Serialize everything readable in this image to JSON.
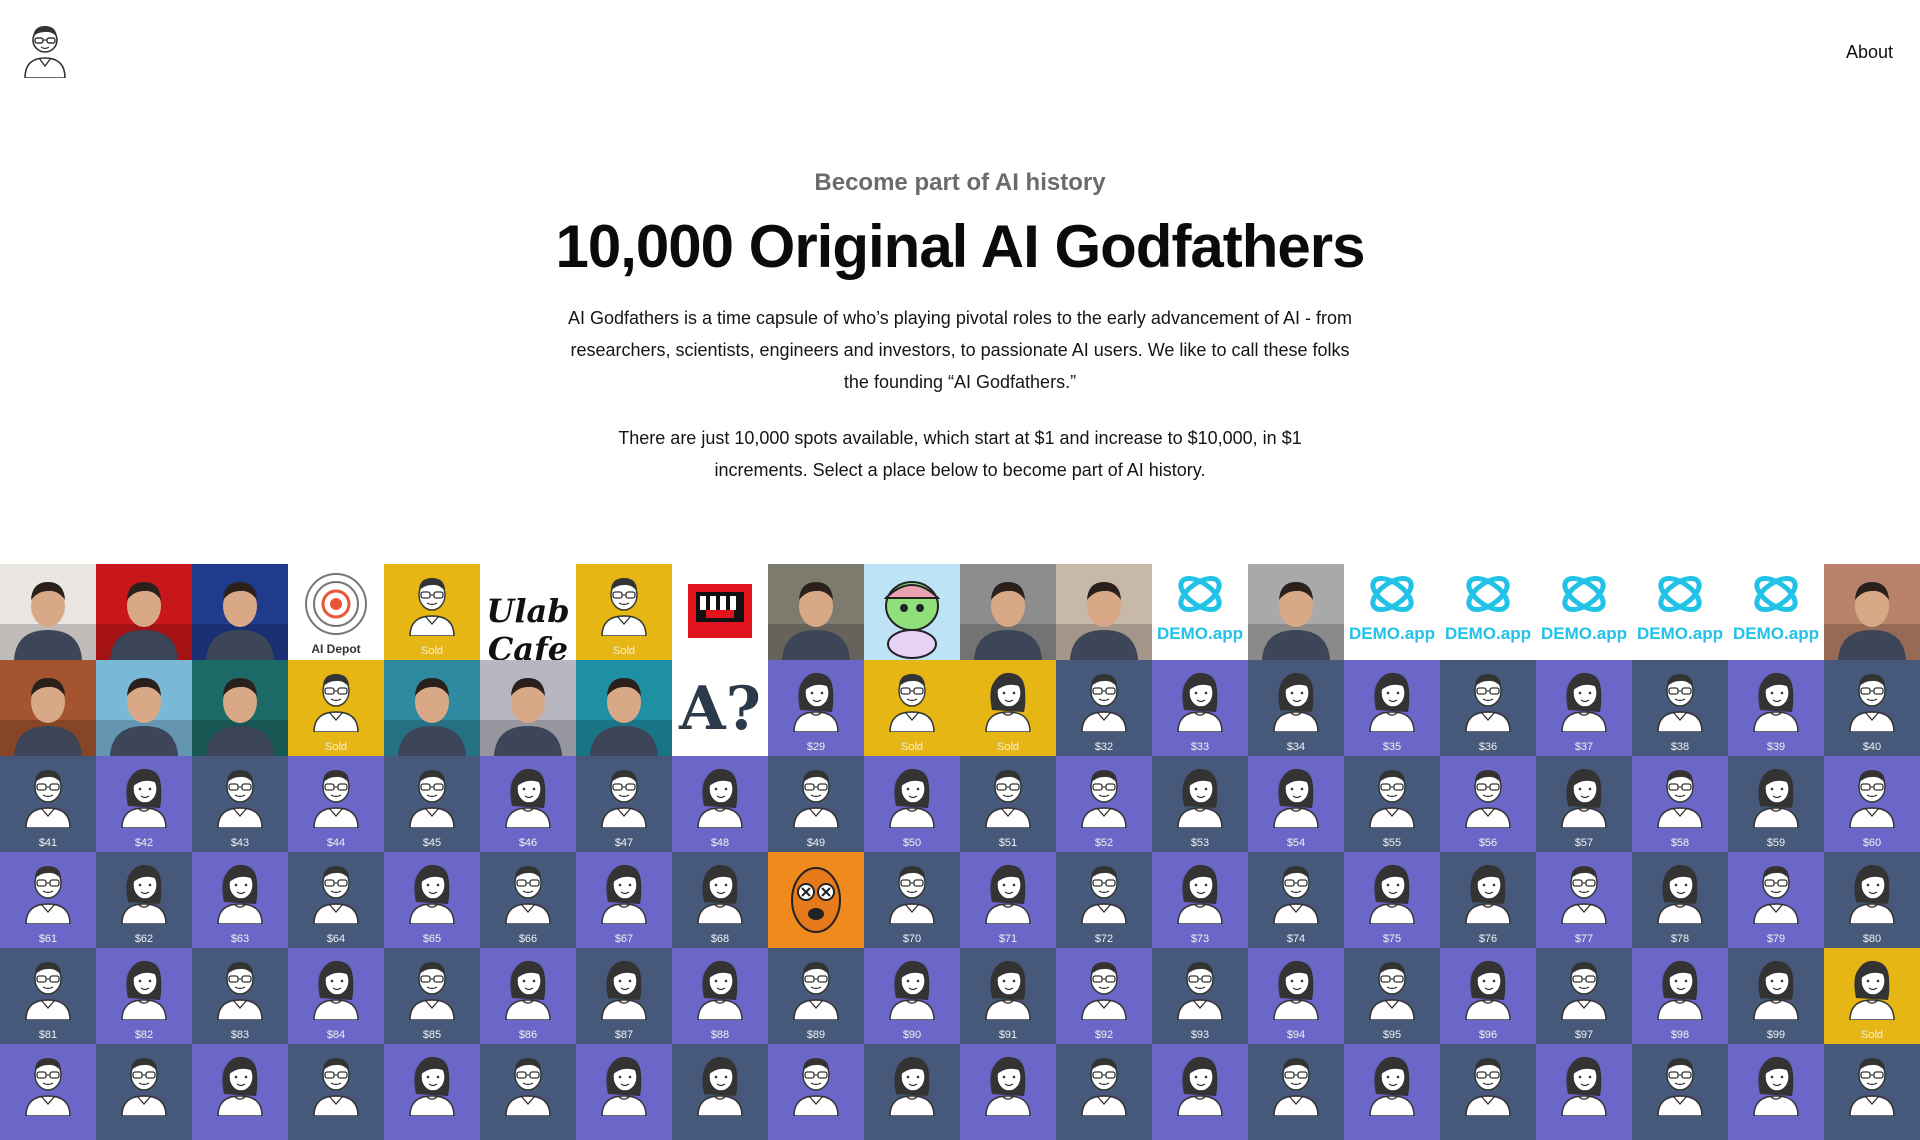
{
  "header": {
    "logo_icon": "godfather-avatar-icon",
    "about_label": "About"
  },
  "hero": {
    "kicker": "Become part of AI history",
    "title": "10,000 Original AI Godfathers",
    "paragraph1": "AI Godfathers is a time capsule of who’s playing pivotal roles to the early advancement of AI - from researchers, scientists, engineers and investors, to passionate AI users. We like to call these folks the founding “AI Godfathers.”",
    "paragraph2": "There are just 10,000 spots available, which start at $1 and increase to $10,000, in $1 increments. Select a place below to become part of AI history."
  },
  "colors": {
    "blue": "#47597a",
    "purple": "#6a67c8",
    "gold": "#e5b614"
  },
  "tiles": [
    {
      "type": "photo",
      "bg": "#e9e5e1"
    },
    {
      "type": "photo",
      "bg": "#c8171b"
    },
    {
      "type": "photo",
      "bg": "#1f3b8c"
    },
    {
      "type": "logo",
      "bg": "#ffffff",
      "text": "AI Depot",
      "icon": "target-icon"
    },
    {
      "type": "sold",
      "bg": "#e5b614",
      "label": "Sold",
      "icon": "male-avatar-icon"
    },
    {
      "type": "logo",
      "bg": "#ffffff",
      "text": "Ulab Cafe",
      "icon": "blackletter-logo"
    },
    {
      "type": "sold",
      "bg": "#e5b614",
      "label": "Sold",
      "icon": "male-avatar-icon"
    },
    {
      "type": "logo",
      "bg": "#ffffff",
      "text": "",
      "icon": "red-piano-icon"
    },
    {
      "type": "photo",
      "bg": "#7d7a6e"
    },
    {
      "type": "art",
      "bg": "#bfe3f6",
      "icon": "cartoon-ape-icon"
    },
    {
      "type": "photo",
      "bg": "#8d8d8d"
    },
    {
      "type": "photo",
      "bg": "#c7b8a8"
    },
    {
      "type": "logo",
      "bg": "#ffffff",
      "text": "DEMO.app",
      "icon": "demo-app-icon"
    },
    {
      "type": "photo",
      "bg": "#a9a9a9"
    },
    {
      "type": "logo",
      "bg": "#ffffff",
      "text": "DEMO.app",
      "icon": "demo-app-icon"
    },
    {
      "type": "logo",
      "bg": "#ffffff",
      "text": "DEMO.app",
      "icon": "demo-app-icon"
    },
    {
      "type": "logo",
      "bg": "#ffffff",
      "text": "DEMO.app",
      "icon": "demo-app-icon"
    },
    {
      "type": "logo",
      "bg": "#ffffff",
      "text": "DEMO.app",
      "icon": "demo-app-icon"
    },
    {
      "type": "logo",
      "bg": "#ffffff",
      "text": "DEMO.app",
      "icon": "demo-app-icon"
    },
    {
      "type": "photo",
      "bg": "#b9826a"
    },
    {
      "type": "photo",
      "bg": "#a4552f"
    },
    {
      "type": "photo",
      "bg": "#7ab8d8"
    },
    {
      "type": "photo",
      "bg": "#1b6a66"
    },
    {
      "type": "sold",
      "bg": "#e5b614",
      "label": "Sold",
      "icon": "male-avatar-icon"
    },
    {
      "type": "photo",
      "bg": "#2e8aa0"
    },
    {
      "type": "photo",
      "bg": "#b7b7c2"
    },
    {
      "type": "photo",
      "bg": "#1f8fa3"
    },
    {
      "type": "logo",
      "bg": "#ffffff",
      "text": "A?",
      "icon": "letter-art-icon"
    },
    {
      "type": "price",
      "bg": "#6a67c8",
      "label": "$29",
      "icon": "female-avatar-icon"
    },
    {
      "type": "sold",
      "bg": "#e5b614",
      "label": "Sold",
      "icon": "male-avatar-icon"
    },
    {
      "type": "sold",
      "bg": "#e5b614",
      "label": "Sold",
      "icon": "female-avatar-icon"
    },
    {
      "type": "price",
      "bg": "#47597a",
      "label": "$32",
      "icon": "male-avatar-icon"
    },
    {
      "type": "price",
      "bg": "#6a67c8",
      "label": "$33",
      "icon": "female-avatar-icon"
    },
    {
      "type": "price",
      "bg": "#47597a",
      "label": "$34",
      "icon": "female-avatar-icon"
    },
    {
      "type": "price",
      "bg": "#6a67c8",
      "label": "$35",
      "icon": "female-avatar-icon"
    },
    {
      "type": "price",
      "bg": "#47597a",
      "label": "$36",
      "icon": "male-avatar-icon"
    },
    {
      "type": "price",
      "bg": "#6a67c8",
      "label": "$37",
      "icon": "female-avatar-icon"
    },
    {
      "type": "price",
      "bg": "#47597a",
      "label": "$38",
      "icon": "male-avatar-icon"
    },
    {
      "type": "price",
      "bg": "#6a67c8",
      "label": "$39",
      "icon": "female-avatar-icon"
    },
    {
      "type": "price",
      "bg": "#47597a",
      "label": "$40",
      "icon": "male-avatar-icon"
    },
    {
      "type": "price",
      "bg": "#47597a",
      "label": "$41",
      "icon": "male-avatar-icon"
    },
    {
      "type": "price",
      "bg": "#6a67c8",
      "label": "$42",
      "icon": "female-avatar-icon"
    },
    {
      "type": "price",
      "bg": "#47597a",
      "label": "$43",
      "icon": "male-avatar-icon"
    },
    {
      "type": "price",
      "bg": "#6a67c8",
      "label": "$44",
      "icon": "male-avatar-icon"
    },
    {
      "type": "price",
      "bg": "#47597a",
      "label": "$45",
      "icon": "male-avatar-icon"
    },
    {
      "type": "price",
      "bg": "#6a67c8",
      "label": "$46",
      "icon": "female-avatar-icon"
    },
    {
      "type": "price",
      "bg": "#47597a",
      "label": "$47",
      "icon": "male-avatar-icon"
    },
    {
      "type": "price",
      "bg": "#6a67c8",
      "label": "$48",
      "icon": "female-avatar-icon"
    },
    {
      "type": "price",
      "bg": "#47597a",
      "label": "$49",
      "icon": "male-avatar-icon"
    },
    {
      "type": "price",
      "bg": "#6a67c8",
      "label": "$50",
      "icon": "female-avatar-icon"
    },
    {
      "type": "price",
      "bg": "#47597a",
      "label": "$51",
      "icon": "male-avatar-icon"
    },
    {
      "type": "price",
      "bg": "#6a67c8",
      "label": "$52",
      "icon": "male-avatar-icon"
    },
    {
      "type": "price",
      "bg": "#47597a",
      "label": "$53",
      "icon": "female-avatar-icon"
    },
    {
      "type": "price",
      "bg": "#6a67c8",
      "label": "$54",
      "icon": "female-avatar-icon"
    },
    {
      "type": "price",
      "bg": "#47597a",
      "label": "$55",
      "icon": "male-avatar-icon"
    },
    {
      "type": "price",
      "bg": "#6a67c8",
      "label": "$56",
      "icon": "male-avatar-icon"
    },
    {
      "type": "price",
      "bg": "#47597a",
      "label": "$57",
      "icon": "female-avatar-icon"
    },
    {
      "type": "price",
      "bg": "#6a67c8",
      "label": "$58",
      "icon": "male-avatar-icon"
    },
    {
      "type": "price",
      "bg": "#47597a",
      "label": "$59",
      "icon": "female-avatar-icon"
    },
    {
      "type": "price",
      "bg": "#6a67c8",
      "label": "$60",
      "icon": "male-avatar-icon"
    },
    {
      "type": "price",
      "bg": "#6a67c8",
      "label": "$61",
      "icon": "male-avatar-icon"
    },
    {
      "type": "price",
      "bg": "#47597a",
      "label": "$62",
      "icon": "female-avatar-icon"
    },
    {
      "type": "price",
      "bg": "#6a67c8",
      "label": "$63",
      "icon": "female-avatar-icon"
    },
    {
      "type": "price",
      "bg": "#47597a",
      "label": "$64",
      "icon": "male-avatar-icon"
    },
    {
      "type": "price",
      "bg": "#6a67c8",
      "label": "$65",
      "icon": "female-avatar-icon"
    },
    {
      "type": "price",
      "bg": "#47597a",
      "label": "$66",
      "icon": "male-avatar-icon"
    },
    {
      "type": "price",
      "bg": "#6a67c8",
      "label": "$67",
      "icon": "female-avatar-icon"
    },
    {
      "type": "price",
      "bg": "#47597a",
      "label": "$68",
      "icon": "female-avatar-icon"
    },
    {
      "type": "art",
      "bg": "#f08a1c",
      "icon": "orange-creature-icon"
    },
    {
      "type": "price",
      "bg": "#47597a",
      "label": "$70",
      "icon": "male-avatar-icon"
    },
    {
      "type": "price",
      "bg": "#6a67c8",
      "label": "$71",
      "icon": "female-avatar-icon"
    },
    {
      "type": "price",
      "bg": "#47597a",
      "label": "$72",
      "icon": "male-avatar-icon"
    },
    {
      "type": "price",
      "bg": "#6a67c8",
      "label": "$73",
      "icon": "female-avatar-icon"
    },
    {
      "type": "price",
      "bg": "#47597a",
      "label": "$74",
      "icon": "male-avatar-icon"
    },
    {
      "type": "price",
      "bg": "#6a67c8",
      "label": "$75",
      "icon": "female-avatar-icon"
    },
    {
      "type": "price",
      "bg": "#47597a",
      "label": "$76",
      "icon": "female-avatar-icon"
    },
    {
      "type": "price",
      "bg": "#6a67c8",
      "label": "$77",
      "icon": "male-avatar-icon"
    },
    {
      "type": "price",
      "bg": "#47597a",
      "label": "$78",
      "icon": "female-avatar-icon"
    },
    {
      "type": "price",
      "bg": "#6a67c8",
      "label": "$79",
      "icon": "male-avatar-icon"
    },
    {
      "type": "price",
      "bg": "#47597a",
      "label": "$80",
      "icon": "female-avatar-icon"
    },
    {
      "type": "price",
      "bg": "#47597a",
      "label": "$81",
      "icon": "male-avatar-icon"
    },
    {
      "type": "price",
      "bg": "#6a67c8",
      "label": "$82",
      "icon": "female-avatar-icon"
    },
    {
      "type": "price",
      "bg": "#47597a",
      "label": "$83",
      "icon": "male-avatar-icon"
    },
    {
      "type": "price",
      "bg": "#6a67c8",
      "label": "$84",
      "icon": "female-avatar-icon"
    },
    {
      "type": "price",
      "bg": "#47597a",
      "label": "$85",
      "icon": "male-avatar-icon"
    },
    {
      "type": "price",
      "bg": "#6a67c8",
      "label": "$86",
      "icon": "female-avatar-icon"
    },
    {
      "type": "price",
      "bg": "#47597a",
      "label": "$87",
      "icon": "female-avatar-icon"
    },
    {
      "type": "price",
      "bg": "#6a67c8",
      "label": "$88",
      "icon": "female-avatar-icon"
    },
    {
      "type": "price",
      "bg": "#47597a",
      "label": "$89",
      "icon": "male-avatar-icon"
    },
    {
      "type": "price",
      "bg": "#6a67c8",
      "label": "$90",
      "icon": "female-avatar-icon"
    },
    {
      "type": "price",
      "bg": "#47597a",
      "label": "$91",
      "icon": "female-avatar-icon"
    },
    {
      "type": "price",
      "bg": "#6a67c8",
      "label": "$92",
      "icon": "male-avatar-icon"
    },
    {
      "type": "price",
      "bg": "#47597a",
      "label": "$93",
      "icon": "male-avatar-icon"
    },
    {
      "type": "price",
      "bg": "#6a67c8",
      "label": "$94",
      "icon": "female-avatar-icon"
    },
    {
      "type": "price",
      "bg": "#47597a",
      "label": "$95",
      "icon": "male-avatar-icon"
    },
    {
      "type": "price",
      "bg": "#6a67c8",
      "label": "$96",
      "icon": "female-avatar-icon"
    },
    {
      "type": "price",
      "bg": "#47597a",
      "label": "$97",
      "icon": "male-avatar-icon"
    },
    {
      "type": "price",
      "bg": "#6a67c8",
      "label": "$98",
      "icon": "female-avatar-icon"
    },
    {
      "type": "price",
      "bg": "#47597a",
      "label": "$99",
      "icon": "female-avatar-icon"
    },
    {
      "type": "sold",
      "bg": "#e5b614",
      "label": "Sold",
      "icon": "female-avatar-icon"
    },
    {
      "type": "price",
      "bg": "#6a67c8",
      "label": "",
      "icon": "male-avatar-icon"
    },
    {
      "type": "price",
      "bg": "#47597a",
      "label": "",
      "icon": "male-avatar-icon"
    },
    {
      "type": "price",
      "bg": "#6a67c8",
      "label": "",
      "icon": "female-avatar-icon"
    },
    {
      "type": "price",
      "bg": "#47597a",
      "label": "",
      "icon": "male-avatar-icon"
    },
    {
      "type": "price",
      "bg": "#6a67c8",
      "label": "",
      "icon": "female-avatar-icon"
    },
    {
      "type": "price",
      "bg": "#47597a",
      "label": "",
      "icon": "male-avatar-icon"
    },
    {
      "type": "price",
      "bg": "#6a67c8",
      "label": "",
      "icon": "female-avatar-icon"
    },
    {
      "type": "price",
      "bg": "#47597a",
      "label": "",
      "icon": "female-avatar-icon"
    },
    {
      "type": "price",
      "bg": "#6a67c8",
      "label": "",
      "icon": "male-avatar-icon"
    },
    {
      "type": "price",
      "bg": "#47597a",
      "label": "",
      "icon": "female-avatar-icon"
    },
    {
      "type": "price",
      "bg": "#6a67c8",
      "label": "",
      "icon": "female-avatar-icon"
    },
    {
      "type": "price",
      "bg": "#47597a",
      "label": "",
      "icon": "male-avatar-icon"
    },
    {
      "type": "price",
      "bg": "#6a67c8",
      "label": "",
      "icon": "female-avatar-icon"
    },
    {
      "type": "price",
      "bg": "#47597a",
      "label": "",
      "icon": "male-avatar-icon"
    },
    {
      "type": "price",
      "bg": "#6a67c8",
      "label": "",
      "icon": "female-avatar-icon"
    },
    {
      "type": "price",
      "bg": "#47597a",
      "label": "",
      "icon": "male-avatar-icon"
    },
    {
      "type": "price",
      "bg": "#6a67c8",
      "label": "",
      "icon": "female-avatar-icon"
    },
    {
      "type": "price",
      "bg": "#47597a",
      "label": "",
      "icon": "male-avatar-icon"
    },
    {
      "type": "price",
      "bg": "#6a67c8",
      "label": "",
      "icon": "female-avatar-icon"
    },
    {
      "type": "price",
      "bg": "#47597a",
      "label": "",
      "icon": "male-avatar-icon"
    }
  ]
}
